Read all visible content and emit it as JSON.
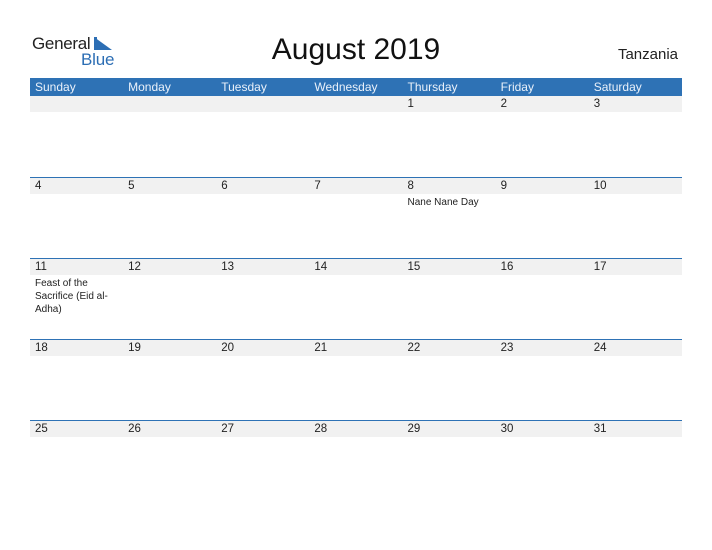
{
  "logo": {
    "general": "General",
    "blue": "Blue",
    "brand_color": "#2c6eb4"
  },
  "title": "August 2019",
  "country": "Tanzania",
  "header_color": "#2e72b5",
  "weekdays": [
    "Sunday",
    "Monday",
    "Tuesday",
    "Wednesday",
    "Thursday",
    "Friday",
    "Saturday"
  ],
  "weeks": [
    {
      "days": [
        "",
        "",
        "",
        "",
        "1",
        "2",
        "3"
      ],
      "events": [
        "",
        "",
        "",
        "",
        "",
        "",
        ""
      ]
    },
    {
      "days": [
        "4",
        "5",
        "6",
        "7",
        "8",
        "9",
        "10"
      ],
      "events": [
        "",
        "",
        "",
        "",
        "Nane Nane Day",
        "",
        ""
      ]
    },
    {
      "days": [
        "11",
        "12",
        "13",
        "14",
        "15",
        "16",
        "17"
      ],
      "events": [
        "Feast of the Sacrifice (Eid al-Adha)",
        "",
        "",
        "",
        "",
        "",
        ""
      ]
    },
    {
      "days": [
        "18",
        "19",
        "20",
        "21",
        "22",
        "23",
        "24"
      ],
      "events": [
        "",
        "",
        "",
        "",
        "",
        "",
        ""
      ]
    },
    {
      "days": [
        "25",
        "26",
        "27",
        "28",
        "29",
        "30",
        "31"
      ],
      "events": [
        "",
        "",
        "",
        "",
        "",
        "",
        ""
      ]
    }
  ]
}
